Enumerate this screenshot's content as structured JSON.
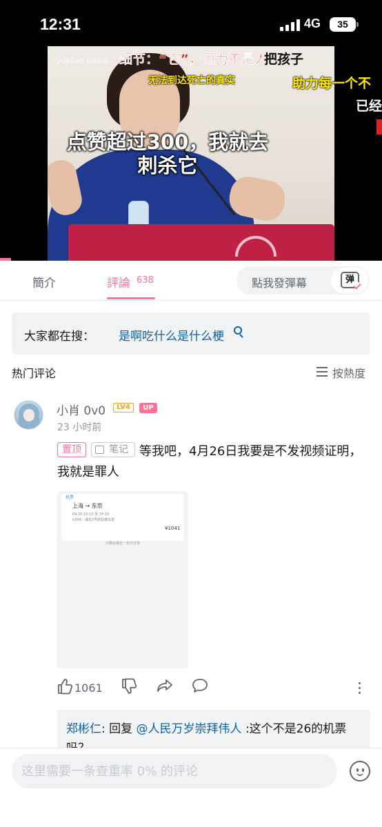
{
  "status_bar": {
    "time": "12:31",
    "network": "4G",
    "battery": "35"
  },
  "video": {
    "watermark": "小肖0v0 bilibili",
    "caption_red": "细节：“它”，因为不是人",
    "caption_black": "把孩子",
    "caption_yellow_small": "无法到达死亡的真实",
    "caption_yellow_right": "助力每一个不",
    "caption_white_right": "已经",
    "caption_main": "点赞超过300，我就去刺杀它"
  },
  "tabs": {
    "intro": "簡介",
    "comments": "評論",
    "comments_count": "638",
    "danmaku_button": "點我發彈幕",
    "danmaku_icon_text": "弹"
  },
  "search_suggest": {
    "prefix": "大家都在搜：",
    "term": "是啊吃什么是什么梗"
  },
  "hot_comments": {
    "title": "热门评论",
    "sort_label": "按熱度"
  },
  "comment": {
    "username": "小肖 0v0",
    "level": "LV4",
    "up_badge": "UP",
    "time": "23 小时前",
    "pinned_label": "置顶",
    "note_label": "笔记",
    "text": "等我吧，4月26日我要是不发视频证明，我就是罪人",
    "like_count": "1061",
    "ticket": {
      "app": "机票",
      "route": "上海 → 东京",
      "time": "04-26 10:10 至 14:10",
      "detail": "U006 · 浦东2号航站楼出发",
      "price": "¥1041",
      "footer": "只展示最近一年内订单"
    },
    "reply": {
      "user": "郑彬仁",
      "verb": ": 回复 ",
      "mention": "@人民万岁崇拜伟人",
      "text": " :这个不是26的机票吗？"
    }
  },
  "bottom_input": {
    "placeholder": "这里需要一条查重率 0% 的评论"
  }
}
